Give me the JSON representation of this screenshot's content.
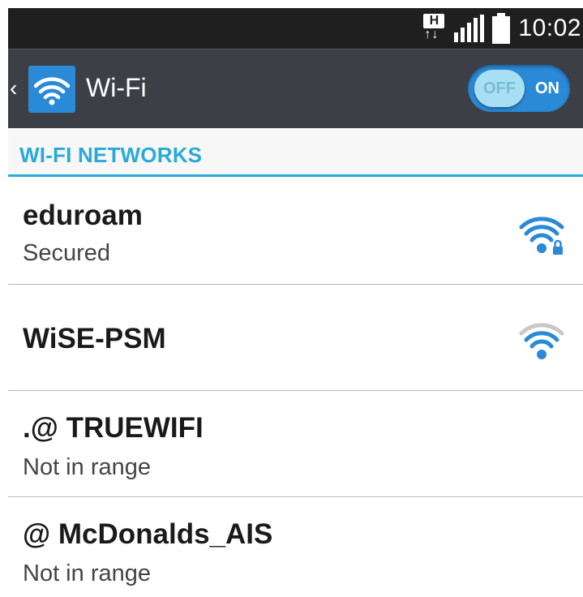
{
  "status_bar": {
    "network_type": "H",
    "network_arrows": "↑↓",
    "time": "10:02"
  },
  "action_bar": {
    "back_icon": "chevron-left-icon",
    "app_icon": "wifi-icon",
    "title": "Wi-Fi",
    "toggle": {
      "off_label": "OFF",
      "on_label": "ON",
      "state": "on"
    }
  },
  "section": {
    "title": "WI-FI NETWORKS"
  },
  "networks": [
    {
      "name": "eduroam",
      "status": "Secured",
      "signal_icon": "wifi-locked-icon"
    },
    {
      "name": "WiSE-PSM",
      "status": "",
      "signal_icon": "wifi-icon"
    },
    {
      "name": ".@  TRUEWIFI",
      "status": "Not in range"
    },
    {
      "name": "@ McDonalds_AIS",
      "status": "Not in range"
    }
  ],
  "colors": {
    "accent": "#2aa9d8",
    "action_bar": "#3c3f45",
    "status_bar": "#1f1f1f",
    "wifi_blue": "#2a8ad8"
  }
}
